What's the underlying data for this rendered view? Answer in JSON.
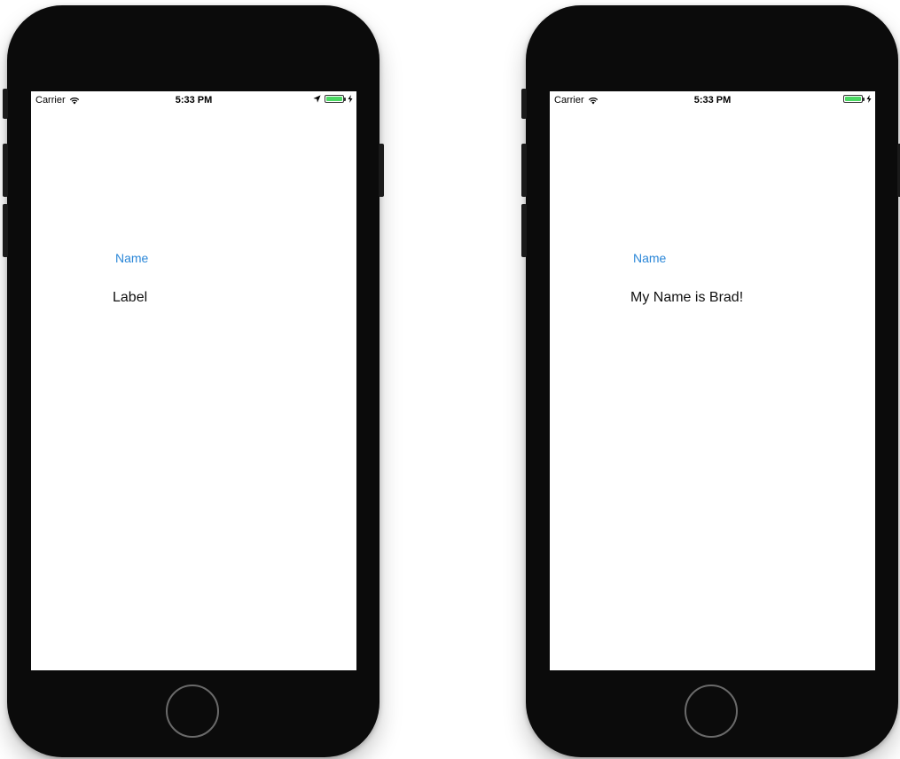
{
  "devices": [
    {
      "status": {
        "carrier": "Carrier",
        "time": "5:33 PM",
        "battery_level": 1.0,
        "show_location": true
      },
      "button_label": "Name",
      "output_text": "Label"
    },
    {
      "status": {
        "carrier": "Carrier",
        "time": "5:33 PM",
        "battery_level": 1.0,
        "show_location": false
      },
      "button_label": "Name",
      "output_text": "My Name is Brad!"
    }
  ],
  "colors": {
    "accent": "#2b87d8",
    "battery": "#4cd964",
    "device_body": "#0b0b0b"
  },
  "icons": [
    "wifi-icon",
    "location-icon",
    "battery-icon",
    "charging-icon"
  ]
}
